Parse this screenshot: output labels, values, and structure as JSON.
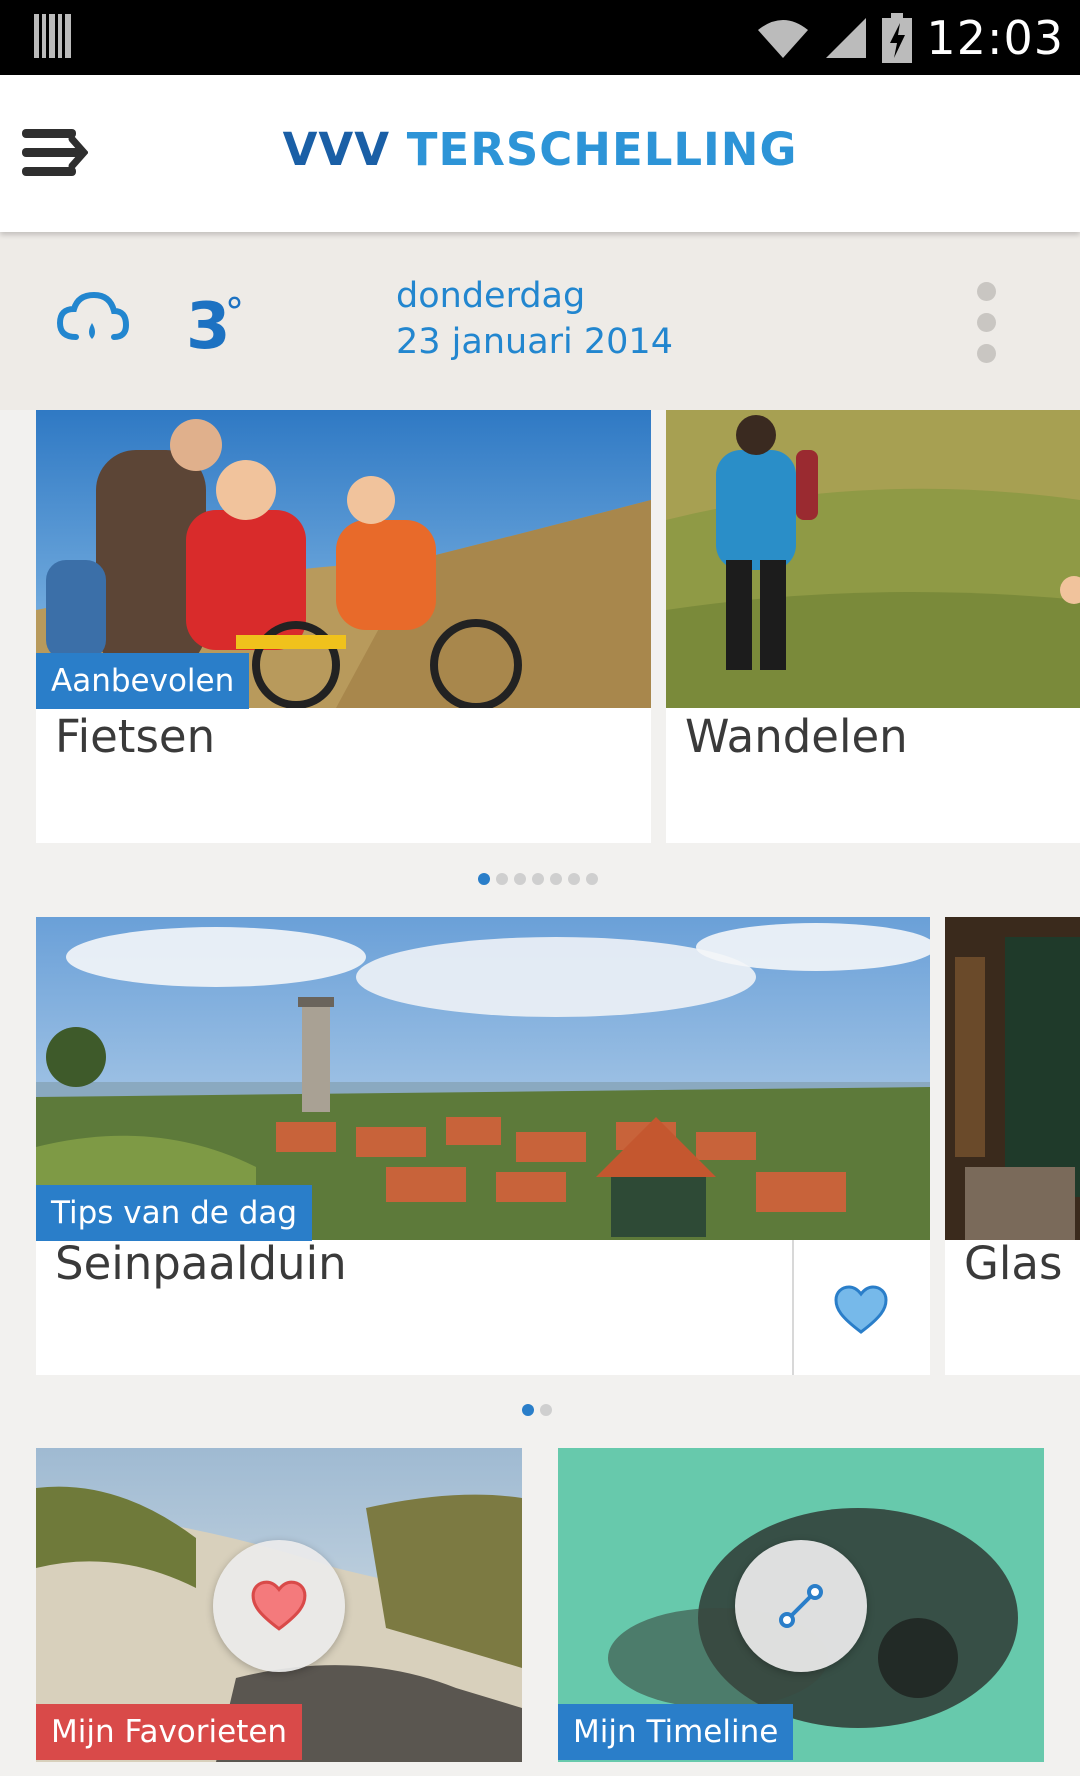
{
  "status_bar": {
    "time": "12:03"
  },
  "app_bar": {
    "brand_part1": "VVV",
    "brand_part2": "TERSCHELLING"
  },
  "weather": {
    "temperature": "3",
    "degree_symbol": "°",
    "day": "donderdag",
    "date": "23 januari 2014",
    "condition_icon": "cloud-rain-icon"
  },
  "recommended": {
    "tag": "Aanbevolen",
    "cards": [
      {
        "title": "Fietsen"
      },
      {
        "title": "Wandelen"
      }
    ],
    "pager": {
      "count": 7,
      "active": 0
    }
  },
  "tips": {
    "tag": "Tips van de dag",
    "cards": [
      {
        "title": "Seinpaalduin"
      },
      {
        "title": "Glas i"
      }
    ],
    "pager": {
      "count": 2,
      "active": 0
    }
  },
  "shortcuts": [
    {
      "label": "Mijn Favorieten",
      "icon": "heart-icon",
      "color": "#d94a49"
    },
    {
      "label": "Mijn Timeline",
      "icon": "route-icon",
      "color": "#2a7ec9"
    }
  ],
  "colors": {
    "accent_blue": "#2a7ec9",
    "brand_dark": "#1a5fa6",
    "brand_light": "#2d94d7",
    "favorite_red": "#d94a49"
  }
}
